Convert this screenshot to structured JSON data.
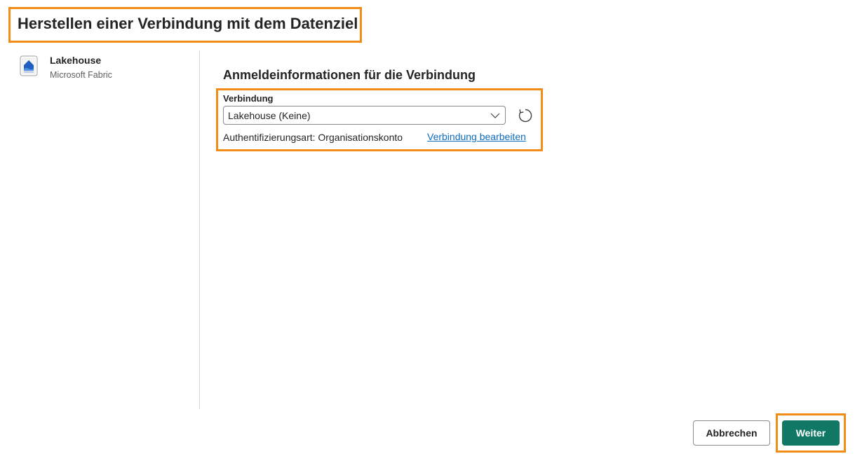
{
  "dialog": {
    "title": "Herstellen einer Verbindung mit dem Datenziel"
  },
  "sidebar": {
    "items": [
      {
        "name": "Lakehouse",
        "provider": "Microsoft Fabric",
        "icon": "lakehouse-icon"
      }
    ]
  },
  "credentials": {
    "section_title": "Anmeldeinformationen für die Verbindung",
    "connection_label": "Verbindung",
    "connection_value": "Lakehouse (Keine)",
    "auth_text": "Authentifizierungsart: Organisationskonto",
    "edit_link": "Verbindung bearbeiten",
    "refresh_icon": "refresh-icon"
  },
  "footer": {
    "cancel_label": "Abbrechen",
    "next_label": "Weiter"
  },
  "colors": {
    "highlight": "#f28c18",
    "primary": "#117865",
    "link": "#0f6cbd"
  }
}
